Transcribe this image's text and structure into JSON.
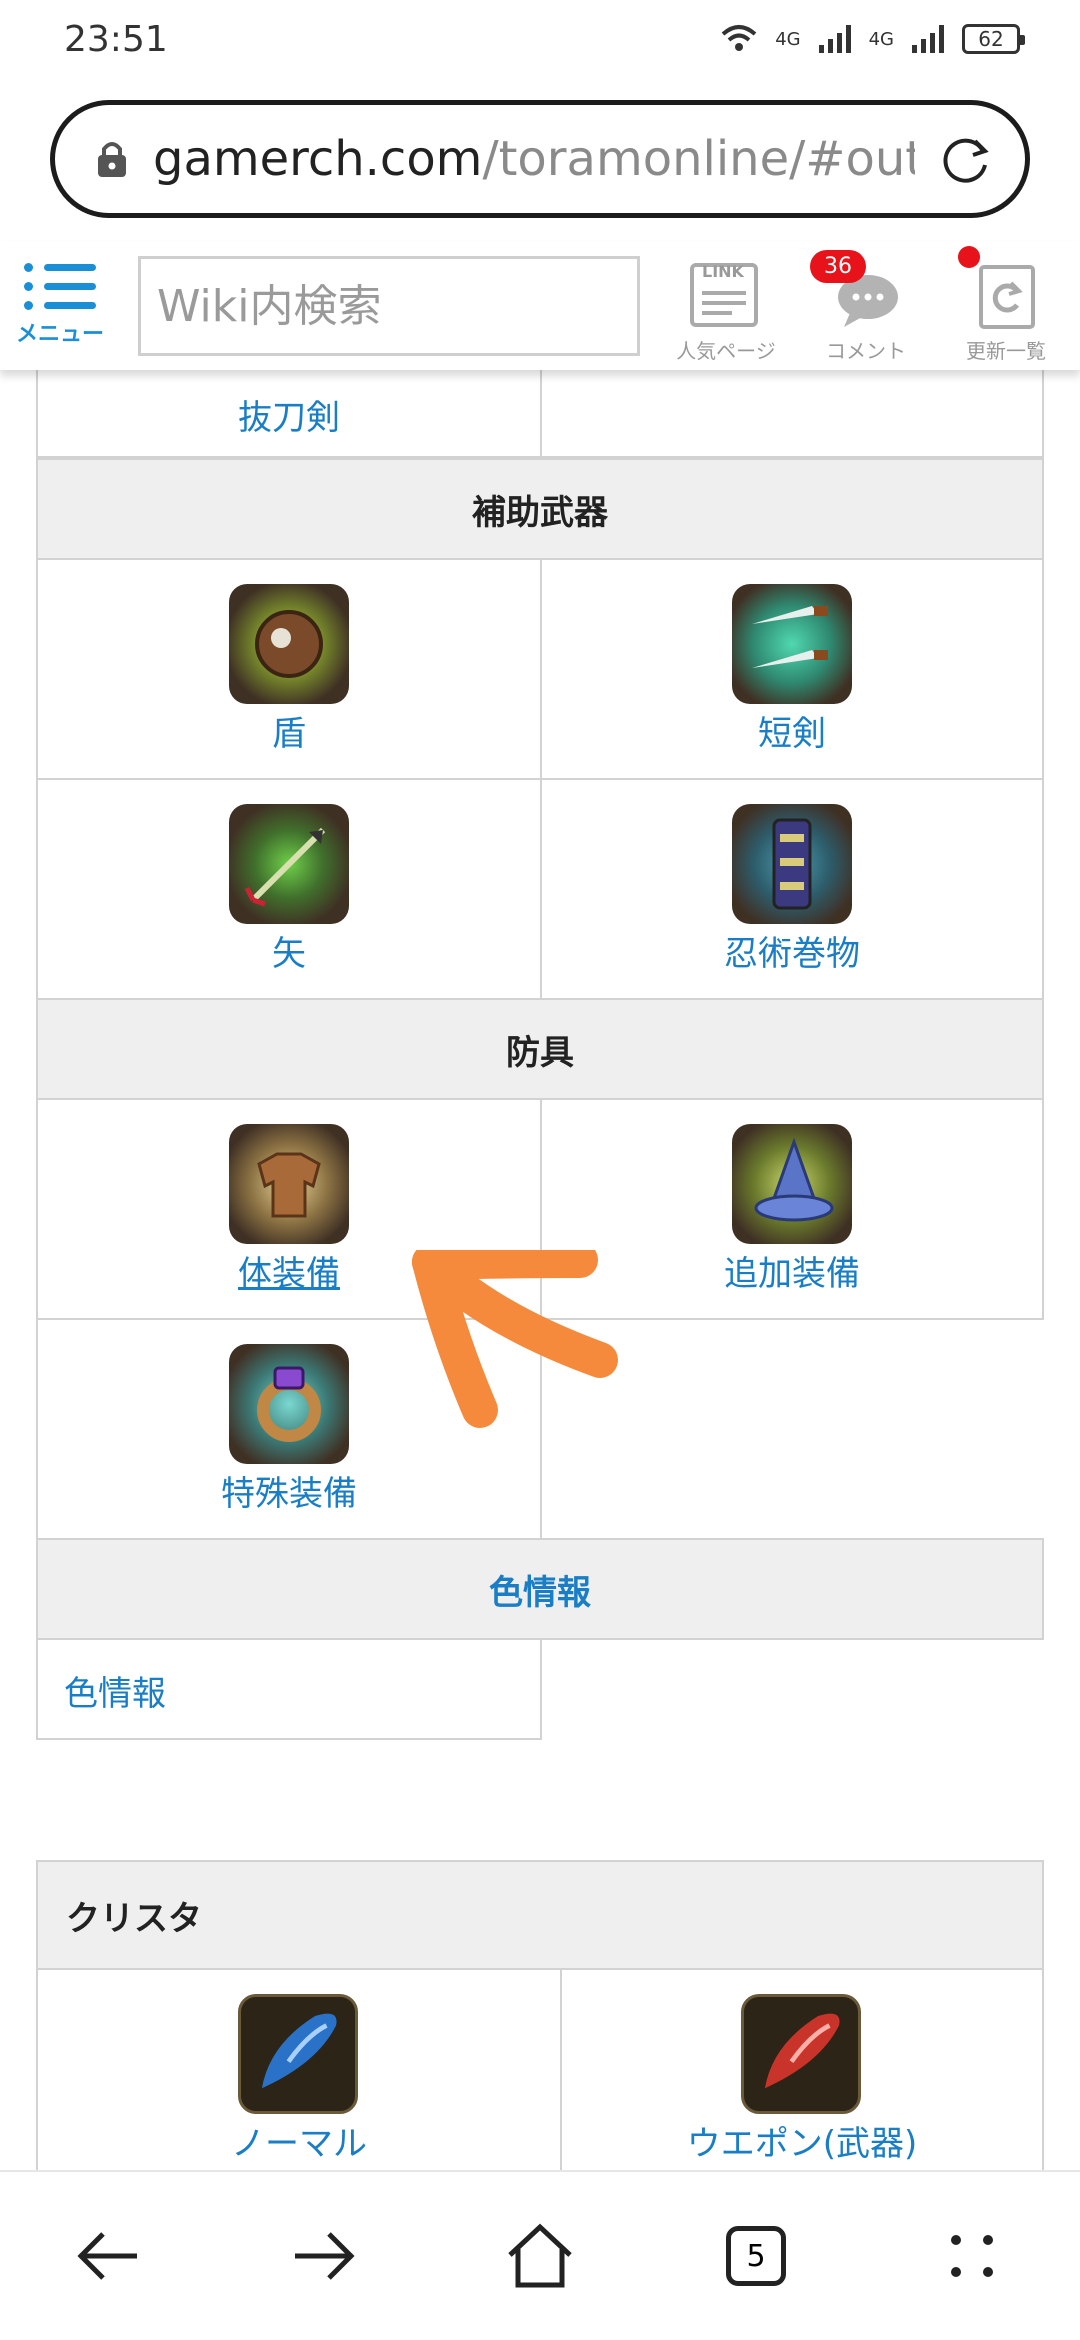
{
  "status": {
    "time": "23:51",
    "network": "4G",
    "network2": "4G",
    "battery": "62"
  },
  "browser": {
    "url_host": "gamerch.com",
    "url_path": "/toramonline/#outlin",
    "tab_count": "5"
  },
  "header": {
    "menu_label": "メニュー",
    "search_placeholder": "Wiki内検索",
    "popular_label": "人気ページ",
    "popular_badge": "LINK",
    "comment_label": "コメント",
    "comment_count": "36",
    "updates_label": "更新一覧"
  },
  "sections": {
    "top_partial": {
      "label": "抜刀剣"
    },
    "sub_weapons": {
      "title": "補助武器",
      "items": [
        {
          "label": "盾",
          "icon": "shield-icon"
        },
        {
          "label": "短剣",
          "icon": "dagger-icon"
        },
        {
          "label": "矢",
          "icon": "arrow-icon"
        },
        {
          "label": "忍術巻物",
          "icon": "scroll-icon"
        }
      ]
    },
    "armor": {
      "title": "防具",
      "items": [
        {
          "label": "体装備",
          "icon": "body-armor-icon"
        },
        {
          "label": "追加装備",
          "icon": "wizard-hat-icon"
        },
        {
          "label": "特殊装備",
          "icon": "ring-icon"
        }
      ]
    },
    "color_info": {
      "title": "色情報",
      "items": [
        {
          "label": "色情報"
        }
      ]
    },
    "crysta": {
      "title": "クリスタ",
      "items": [
        {
          "label": "ノーマル",
          "icon": "blue-crysta-icon"
        },
        {
          "label": "ウエポン(武器)",
          "icon": "red-crysta-icon"
        }
      ]
    }
  },
  "colors": {
    "link": "#1a7ec6",
    "accent": "#1a8fd6",
    "badge": "#e8121a",
    "annotation": "#f58a3c"
  }
}
